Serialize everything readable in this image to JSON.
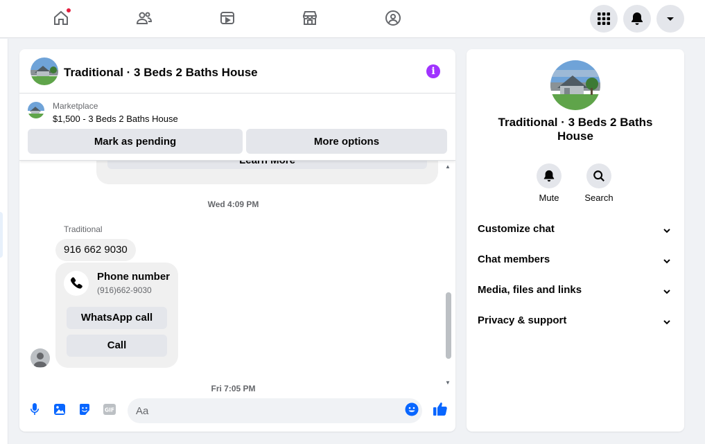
{
  "nav": {
    "icons": [
      "home-icon",
      "friends-icon",
      "video-icon",
      "marketplace-icon",
      "groups-icon"
    ],
    "right_buttons": [
      "menu-grid-icon",
      "notifications-bell-icon",
      "account-caret-icon"
    ]
  },
  "chat": {
    "title": "Traditional · 3 Beds 2 Baths House",
    "marketplace_label": "Marketplace",
    "listing": "$1,500 - 3 Beds 2 Baths House",
    "mark_pending": "Mark as pending",
    "more_options": "More options",
    "learn_more": "Learn More",
    "timestamp_1": "Wed 4:09 PM",
    "sender": "Traditional",
    "message": "916 662 9030",
    "phone_card": {
      "title": "Phone number",
      "number": "(916)662-9030",
      "whatsapp": "WhatsApp call",
      "call": "Call"
    },
    "timestamp_2": "Fri 7:05 PM",
    "composer_placeholder": "Aa"
  },
  "details": {
    "title": "Traditional · 3 Beds 2 Baths House",
    "mute": "Mute",
    "search": "Search",
    "sections": [
      "Customize chat",
      "Chat members",
      "Media, files and links",
      "Privacy & support"
    ]
  },
  "colors": {
    "accent": "#0866ff",
    "info": "#a033ff",
    "notification_dot": "#e41e3f"
  }
}
